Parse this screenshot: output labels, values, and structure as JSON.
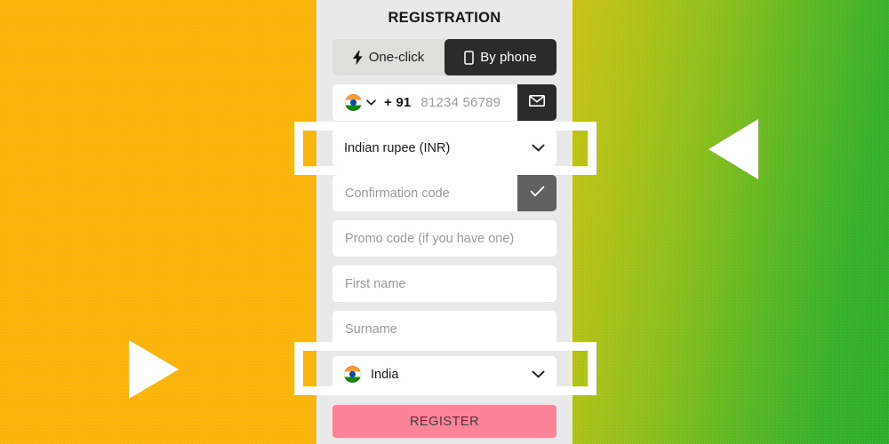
{
  "background": {
    "left_color": "#fbb50b",
    "right_gradient_from": "#c9c313",
    "right_gradient_to": "#2eae2c"
  },
  "markers": {
    "left_arrow_name": "play-triangle-right",
    "right_arrow_name": "play-triangle-left",
    "highlight_color": "#ffffff"
  },
  "panel": {
    "title": "REGISTRATION",
    "background_color": "#e9e9e9"
  },
  "tabs": [
    {
      "label": "One-click",
      "icon": "lightning-bolt-icon",
      "active": false
    },
    {
      "label": "By phone",
      "icon": "mobile-phone-icon",
      "active": true
    }
  ],
  "phone_row": {
    "flag": "india-flag-icon",
    "country_code": "+ 91",
    "placeholder": "81234 56789",
    "value": "",
    "action_icon": "envelope-icon",
    "action_color": "#2b2b2b"
  },
  "currency_select": {
    "label": "Indian rupee (INR)",
    "value": "Indian rupee (INR)",
    "chevron": "chevron-down-icon",
    "highlighted": true
  },
  "confirmation_row": {
    "placeholder": "Confirmation code",
    "value": "",
    "action_icon": "check-icon",
    "action_color": "#616161"
  },
  "fields": [
    {
      "name": "promo-code",
      "placeholder": "Promo code (if you have one)",
      "value": ""
    },
    {
      "name": "first-name",
      "placeholder": "First name",
      "value": ""
    },
    {
      "name": "surname",
      "placeholder": "Surname",
      "value": ""
    }
  ],
  "country_select": {
    "flag": "india-flag-icon",
    "value": "India",
    "chevron": "chevron-down-icon",
    "highlighted": true
  },
  "register_button": {
    "label": "REGISTER",
    "color": "#fa8399",
    "text_color": "#3d3d3d"
  }
}
